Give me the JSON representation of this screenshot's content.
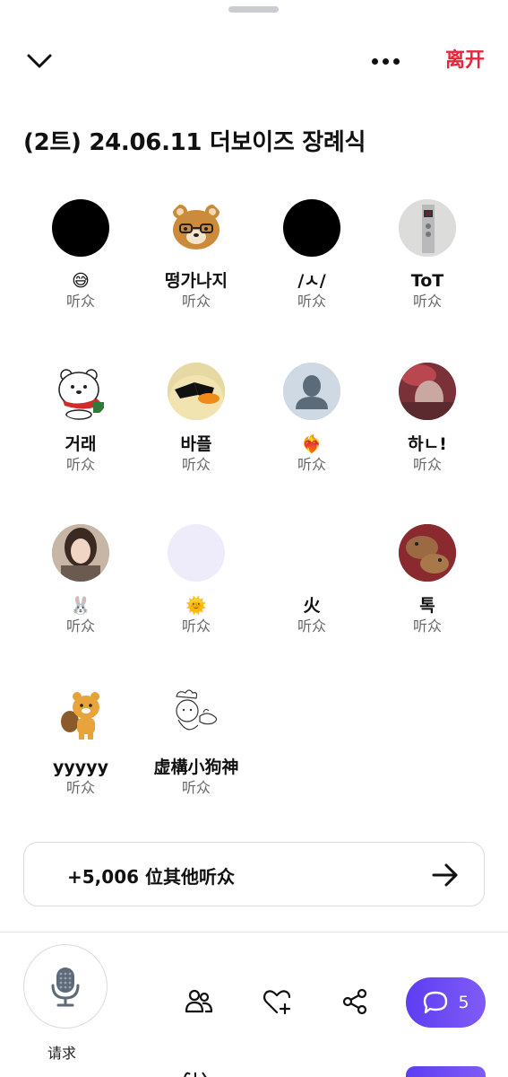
{
  "header": {
    "leave_label": "离开"
  },
  "space": {
    "title": "(2트) 24.06.11 더보이즈 장례식"
  },
  "participants": [
    {
      "name": "😅",
      "role": "听众",
      "avatar": "black"
    },
    {
      "name": "떵가나지",
      "role": "听众",
      "avatar": "bear"
    },
    {
      "name": "/ㅅ/",
      "role": "听众",
      "avatar": "black"
    },
    {
      "name": "ToT",
      "role": "听众",
      "avatar": "elevator"
    },
    {
      "name": "거래",
      "role": "听众",
      "avatar": "polar-bear"
    },
    {
      "name": "바플",
      "role": "听众",
      "avatar": "duck"
    },
    {
      "name": "❤️‍🔥",
      "role": "听众",
      "avatar": "default"
    },
    {
      "name": "하ㄴ!",
      "role": "听众",
      "avatar": "photo-red"
    },
    {
      "name": "🐰",
      "role": "听众",
      "avatar": "photo-girl"
    },
    {
      "name": "🌞",
      "role": "听众",
      "avatar": "lavender"
    },
    {
      "name": "火",
      "role": "听众",
      "avatar": "none"
    },
    {
      "name": "톡",
      "role": "听众",
      "avatar": "capybara"
    },
    {
      "name": "yyyyy",
      "role": "听众",
      "avatar": "ryan"
    },
    {
      "name": "虚構小狗神",
      "role": "听众",
      "avatar": "chef-doodle"
    }
  ],
  "more_listeners": {
    "label": "+5,006 位其他听众"
  },
  "bottom_bar": {
    "request_label": "请求",
    "chat_count": "5"
  },
  "colors": {
    "accent_red": "#e8253d",
    "chat_gradient_start": "#5d3df2",
    "chat_gradient_end": "#7f5cf6",
    "role_gray": "#666666"
  }
}
